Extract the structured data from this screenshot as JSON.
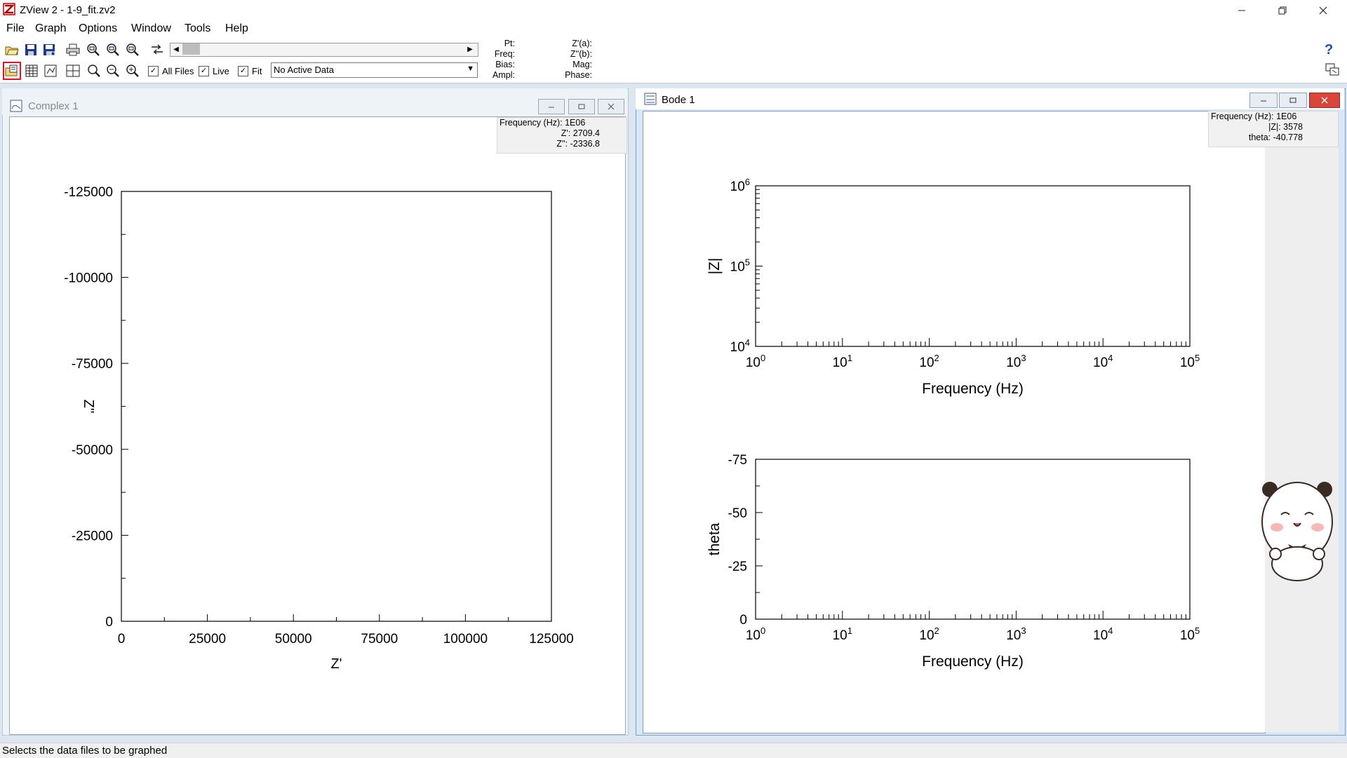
{
  "window": {
    "title": "ZView 2 - 1-9_fit.zv2"
  },
  "menu": [
    "File",
    "Graph",
    "Options",
    "Window",
    "Tools",
    "Help"
  ],
  "toolbar": {
    "checkboxes": [
      {
        "label": "All Files",
        "checked": true
      },
      {
        "label": "Live",
        "checked": true
      },
      {
        "label": "Fit",
        "checked": true
      }
    ],
    "data_select": "No Active Data",
    "info_labels_left": [
      "Pt:",
      "Freq:",
      "Bias:",
      "Ampl:"
    ],
    "info_labels_right": [
      "Z'(a):",
      "Z''(b):",
      "Mag:",
      "Phase:"
    ],
    "help_glyph": "?"
  },
  "complex_window": {
    "title": "Complex 1",
    "readout": [
      "Frequency (Hz): 1E06",
      "Z': 2709.4",
      "Z'': -2336.8"
    ]
  },
  "bode_window": {
    "title": "Bode 1",
    "readout": [
      "Frequency (Hz): 1E06",
      "|Z|: 3578",
      "theta: -40.778"
    ]
  },
  "status": {
    "text": "Selects the data files to be graphed"
  },
  "colors": {
    "accent_red": "#e81123",
    "mdi_background": "#dce6f0",
    "inactive_title": "#eaf1f8",
    "active_title": "#ffffff"
  },
  "chart_data": [
    {
      "type": "scatter",
      "title": "",
      "xlabel": "Z'",
      "ylabel": "Z''",
      "xlim": [
        0,
        125000
      ],
      "ylim": [
        0,
        -125000
      ],
      "x_ticks": [
        "0",
        "25000",
        "50000",
        "75000",
        "100000",
        "125000"
      ],
      "y_ticks": [
        "-125000",
        "-100000",
        "-75000",
        "-50000",
        "-25000",
        "0"
      ],
      "series": []
    },
    {
      "type": "line",
      "title": "",
      "xlabel": "Frequency (Hz)",
      "ylabel": "|Z|",
      "xscale": "log",
      "yscale": "log",
      "xlim": [
        1,
        100000
      ],
      "ylim": [
        10000,
        1000000
      ],
      "x_ticks": [
        {
          "base": "10",
          "exp": "0"
        },
        {
          "base": "10",
          "exp": "1"
        },
        {
          "base": "10",
          "exp": "2"
        },
        {
          "base": "10",
          "exp": "3"
        },
        {
          "base": "10",
          "exp": "4"
        },
        {
          "base": "10",
          "exp": "5"
        }
      ],
      "y_ticks": [
        {
          "base": "10",
          "exp": "6"
        },
        {
          "base": "10",
          "exp": "5"
        },
        {
          "base": "10",
          "exp": "4"
        }
      ],
      "series": []
    },
    {
      "type": "line",
      "title": "",
      "xlabel": "Frequency (Hz)",
      "ylabel": "theta",
      "xscale": "log",
      "xlim": [
        1,
        100000
      ],
      "ylim": [
        0,
        -75
      ],
      "x_ticks": [
        {
          "base": "10",
          "exp": "0"
        },
        {
          "base": "10",
          "exp": "1"
        },
        {
          "base": "10",
          "exp": "2"
        },
        {
          "base": "10",
          "exp": "3"
        },
        {
          "base": "10",
          "exp": "4"
        },
        {
          "base": "10",
          "exp": "5"
        }
      ],
      "y_ticks": [
        "-75",
        "-50",
        "-25",
        "0"
      ],
      "series": []
    }
  ]
}
